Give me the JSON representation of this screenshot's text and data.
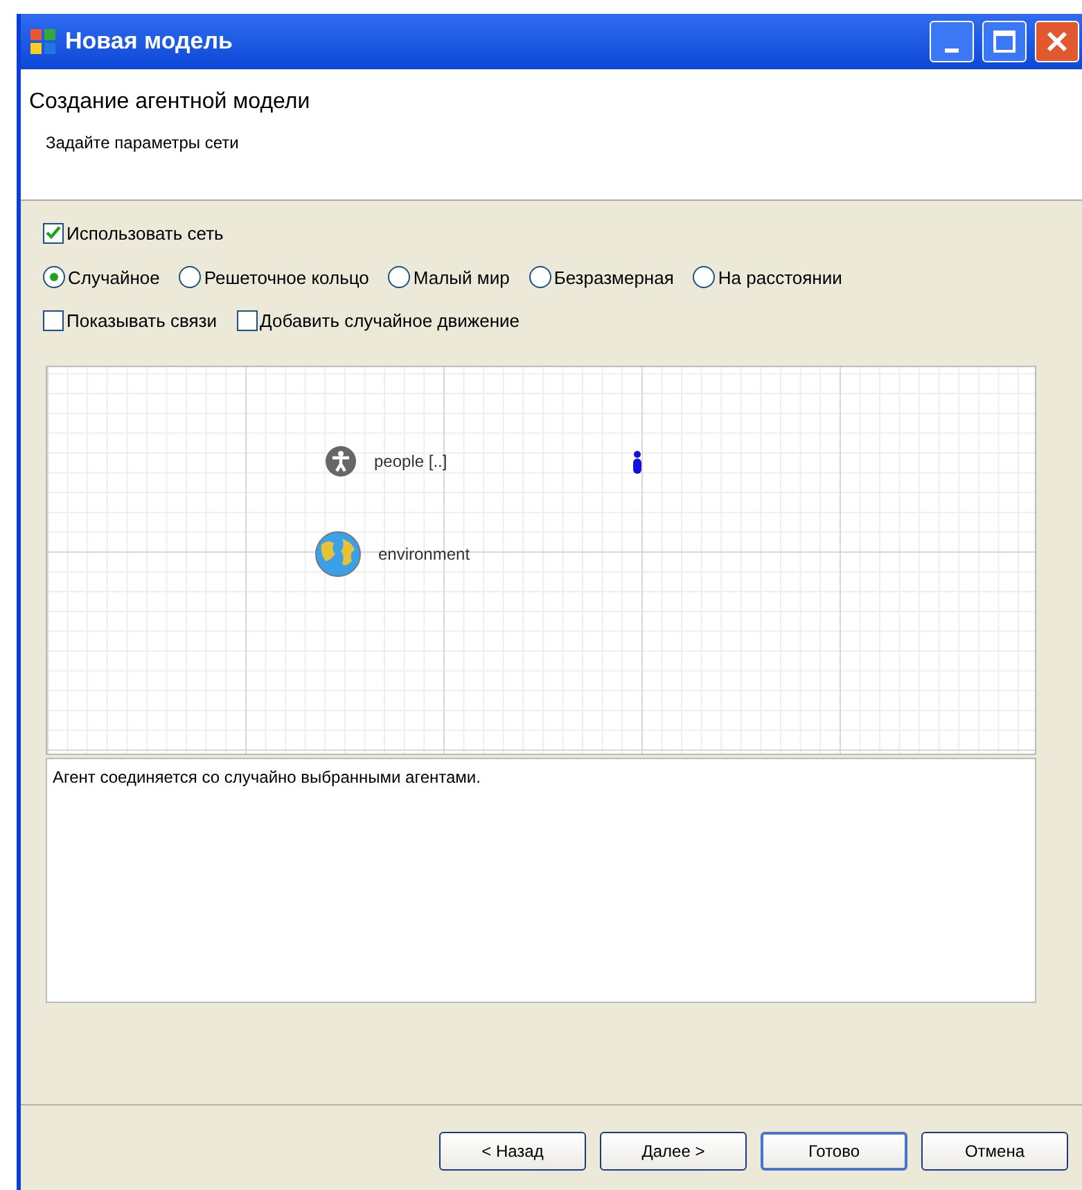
{
  "window": {
    "title": "Новая модель"
  },
  "header": {
    "title": "Создание агентной модели",
    "subtitle": "Задайте параметры сети"
  },
  "use_network": {
    "label": "Использовать сеть",
    "checked": true
  },
  "network_types": [
    {
      "label": "Случайное",
      "selected": true
    },
    {
      "label": "Решеточное кольцо",
      "selected": false
    },
    {
      "label": "Малый мир",
      "selected": false
    },
    {
      "label": "Безразмерная",
      "selected": false
    },
    {
      "label": "На расстоянии",
      "selected": false
    }
  ],
  "options": [
    {
      "label": "Показывать связи",
      "checked": false
    },
    {
      "label": "Добавить случайное движение",
      "checked": false
    }
  ],
  "canvas": {
    "items": [
      {
        "kind": "agent",
        "label": "people [..]"
      },
      {
        "kind": "environment",
        "label": "environment"
      }
    ]
  },
  "description": "Агент соединяется со случайно выбранными агентами.",
  "buttons": [
    {
      "label": "< Назад",
      "default": false
    },
    {
      "label": "Далее >",
      "default": false
    },
    {
      "label": "Готово",
      "default": true
    },
    {
      "label": "Отмена",
      "default": false
    }
  ]
}
